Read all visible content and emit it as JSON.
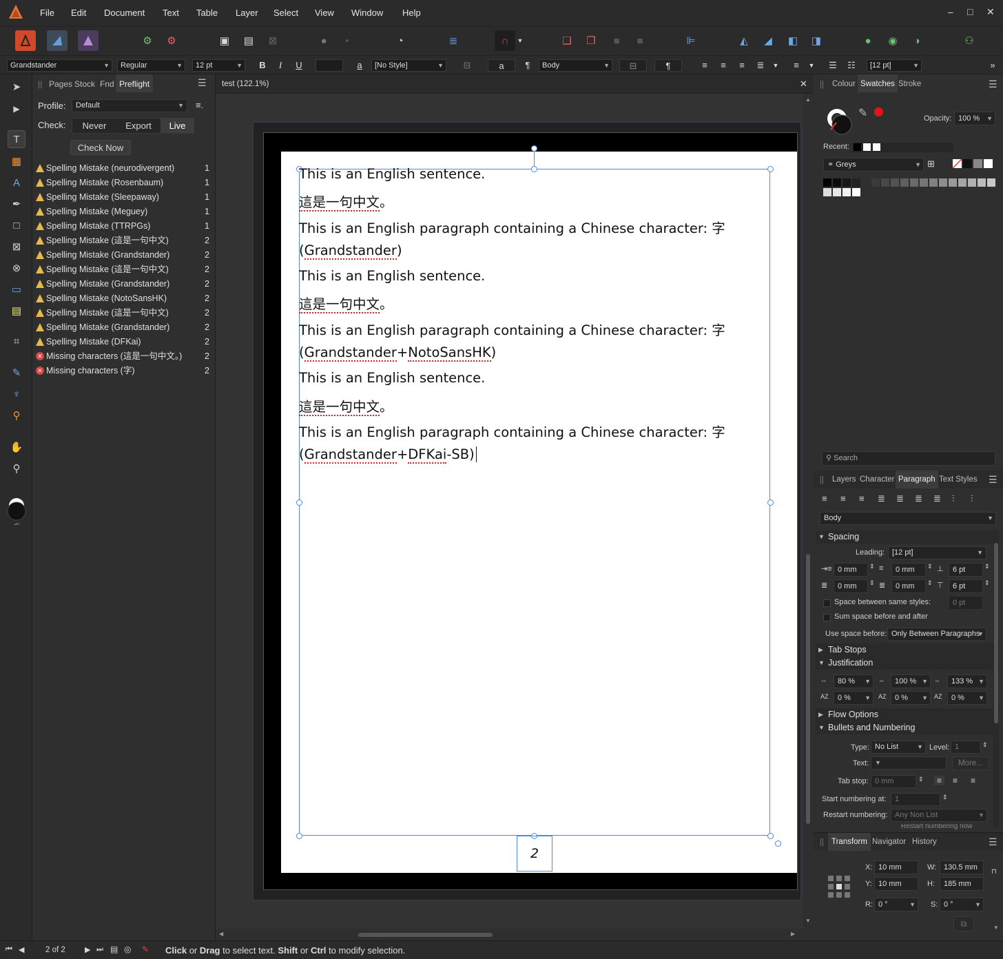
{
  "menu": {
    "items": [
      "File",
      "Edit",
      "Document",
      "Text",
      "Table",
      "Layer",
      "Select",
      "View",
      "Window",
      "Help"
    ],
    "window_controls": [
      "–",
      "□",
      "✕"
    ]
  },
  "context_toolbar": {
    "font_family": "Grandstander",
    "font_style": "Regular",
    "font_size": "12 pt",
    "bold": "B",
    "italic": "I",
    "underline": "U",
    "char_style_glyph": "a",
    "char_style": "[No Style]",
    "a_glyph": "a",
    "pilcrow": "¶",
    "paragraph_style": "Body",
    "leading": "[12 pt]",
    "more": "»"
  },
  "left_panel": {
    "tabs": [
      "Pages",
      "Stock",
      "Fnd",
      "Preflight"
    ],
    "active_tab": "Preflight",
    "profile_label": "Profile:",
    "profile_value": "Default",
    "check_label": "Check:",
    "check_options": [
      "Never",
      "Export",
      "Live"
    ],
    "check_active": "Live",
    "check_now": "Check Now",
    "issues": [
      {
        "type": "warn",
        "label": "Spelling Mistake (neurodivergent)",
        "count": "1"
      },
      {
        "type": "warn",
        "label": "Spelling Mistake (Rosenbaum)",
        "count": "1"
      },
      {
        "type": "warn",
        "label": "Spelling Mistake (Sleepaway)",
        "count": "1"
      },
      {
        "type": "warn",
        "label": "Spelling Mistake (Meguey)",
        "count": "1"
      },
      {
        "type": "warn",
        "label": "Spelling Mistake (TTRPGs)",
        "count": "1"
      },
      {
        "type": "warn",
        "label": "Spelling Mistake (這是一句中文)",
        "count": "2"
      },
      {
        "type": "warn",
        "label": "Spelling Mistake (Grandstander)",
        "count": "2"
      },
      {
        "type": "warn",
        "label": "Spelling Mistake (這是一句中文)",
        "count": "2"
      },
      {
        "type": "warn",
        "label": "Spelling Mistake (Grandstander)",
        "count": "2"
      },
      {
        "type": "warn",
        "label": "Spelling Mistake (NotoSansHK)",
        "count": "2"
      },
      {
        "type": "warn",
        "label": "Spelling Mistake (這是一句中文)",
        "count": "2"
      },
      {
        "type": "warn",
        "label": "Spelling Mistake (Grandstander)",
        "count": "2"
      },
      {
        "type": "warn",
        "label": "Spelling Mistake (DFKai)",
        "count": "2"
      },
      {
        "type": "err",
        "label": "Missing characters (這是一句中文。)",
        "count": "2"
      },
      {
        "type": "err",
        "label": "Missing characters (字)",
        "count": "2"
      }
    ]
  },
  "document": {
    "tab_title": "test (122.1%)",
    "page_number": "2",
    "lines": [
      {
        "text": "This is an English sentence.",
        "squiggle": ""
      },
      {
        "text": "",
        "squiggle": "這是一句中文",
        "tail": "。"
      },
      {
        "text": "This is an English paragraph containing a Chinese character: 字",
        "squiggle": ""
      },
      {
        "text": "(",
        "squiggle": "Grandstander",
        "tail": ")"
      },
      {
        "text": "This is an English sentence.",
        "squiggle": ""
      },
      {
        "text": "",
        "squiggle": "這是一句中文",
        "tail": "。"
      },
      {
        "text": "This is an English paragraph containing a Chinese character: 字",
        "squiggle": ""
      },
      {
        "text": "(",
        "squiggle": "Grandstander",
        "mid": "+",
        "squiggle2": "NotoSansHK",
        "tail": ")"
      },
      {
        "text": "This is an English sentence.",
        "squiggle": ""
      },
      {
        "text": "",
        "squiggle": "這是一句中文",
        "tail": "。"
      },
      {
        "text": "This is an English paragraph containing a Chinese character: 字",
        "squiggle": ""
      },
      {
        "text": "(",
        "squiggle": "Grandstander",
        "mid": "+",
        "squiggle2": "DFKai",
        "tail": "-SB)"
      }
    ]
  },
  "right_panel": {
    "colour_tabs": [
      "Colour",
      "Swatches",
      "Stroke"
    ],
    "colour_active": "Swatches",
    "opacity_label": "Opacity:",
    "opacity_value": "100 %",
    "recent_label": "Recent:",
    "palette": "Greys",
    "search_placeholder": "Search",
    "para_tabs": [
      "Layers",
      "Character",
      "Paragraph",
      "Text Styles"
    ],
    "para_active": "Paragraph",
    "para_style": "Body",
    "spacing": {
      "title": "Spacing",
      "leading_label": "Leading:",
      "leading_value": "[12 pt]",
      "left_indent": "0 mm",
      "first_indent": "0 mm",
      "space_before": "6 pt",
      "right_indent": "0 mm",
      "last_indent": "0 mm",
      "space_after": "6 pt",
      "same_styles_label": "Space between same styles:",
      "same_styles_value": "0 pt",
      "sum_space_label": "Sum space before and after",
      "use_space_label": "Use space before:",
      "use_space_value": "Only Between Paragraphs"
    },
    "tab_stops": "Tab Stops",
    "justification": {
      "title": "Justification",
      "word_min": "80 %",
      "word_desired": "100 %",
      "word_max": "133 %",
      "letter_min": "0 %",
      "letter_desired": "0 %",
      "letter_max": "0 %"
    },
    "flow_options": "Flow Options",
    "bullets": {
      "title": "Bullets and Numbering",
      "type_label": "Type:",
      "type_value": "No List",
      "level_label": "Level:",
      "level_value": "1",
      "text_label": "Text:",
      "more": "More...",
      "tabstop_label": "Tab stop:",
      "tabstop_value": "0 mm",
      "start_label": "Start numbering at:",
      "start_value": "1",
      "restart_label": "Restart numbering:",
      "restart_value": "Any Non List",
      "restart_now": "Restart numbering now"
    },
    "transform_tabs": [
      "Transform",
      "Navigator",
      "History"
    ],
    "transform_active": "Transform",
    "transform": {
      "x_label": "X:",
      "x": "10 mm",
      "y_label": "Y:",
      "y": "10 mm",
      "w_label": "W:",
      "w": "130.5 mm",
      "h_label": "H:",
      "h": "185 mm",
      "r_label": "R:",
      "r": "0 °",
      "s_label": "S:",
      "s": "0 °"
    }
  },
  "status": {
    "page": "2 of 2",
    "hint_click": "Click",
    "hint_or1": " or ",
    "hint_drag": "Drag",
    "hint_mid": " to select text. ",
    "hint_shift": "Shift",
    "hint_or2": " or ",
    "hint_ctrl": "Ctrl",
    "hint_end": " to modify selection."
  },
  "colors": {
    "accent_orange": "#e8743a",
    "selection_blue": "#4a8ae8",
    "warn_yellow": "#e8b84a",
    "error_red": "#d64545"
  }
}
